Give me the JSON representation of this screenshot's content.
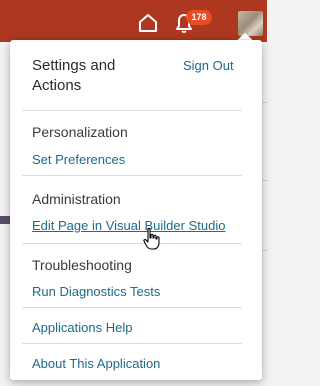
{
  "header": {
    "notification_count": "178",
    "icons": [
      "home-icon",
      "bell-icon",
      "avatar"
    ]
  },
  "menu": {
    "title": "Settings and Actions",
    "sign_out_label": "Sign Out",
    "sections": {
      "personalization": {
        "title": "Personalization",
        "link": "Set Preferences"
      },
      "administration": {
        "title": "Administration",
        "link": "Edit Page in Visual Builder Studio"
      },
      "troubleshooting": {
        "title": "Troubleshooting",
        "link": "Run Diagnostics Tests"
      }
    },
    "applications_help": "Applications Help",
    "about": "About This Application"
  },
  "colors": {
    "header_bg": "#ad371f",
    "badge_bg": "#e94d23",
    "link": "#1e6a8d"
  }
}
